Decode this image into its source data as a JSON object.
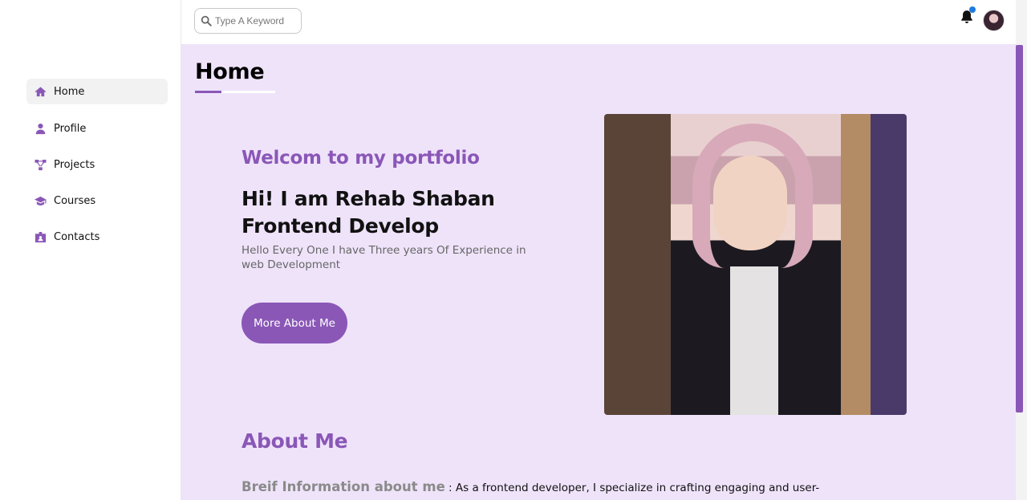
{
  "sidebar": {
    "items": [
      {
        "label": "Home",
        "icon": "home-icon",
        "active": true
      },
      {
        "label": "Profile",
        "icon": "user-icon"
      },
      {
        "label": "Projects",
        "icon": "sitemap-icon"
      },
      {
        "label": "Courses",
        "icon": "graduation-cap-icon"
      },
      {
        "label": "Contacts",
        "icon": "id-card-icon"
      }
    ]
  },
  "header": {
    "search_placeholder": "Type A Keyword",
    "notification_icon": "bell-icon"
  },
  "main": {
    "page_title": "Home",
    "welcome": "Welcom to my portfolio",
    "hero_line1": "Hi! I am Rehab Shaban",
    "hero_line2": "Frontend Develop",
    "hero_description": "Hello Every One I have Three years Of Experience in web Development",
    "more_button": "More About Me",
    "about_title": "About Me",
    "about_label": "Breif Information about me",
    "about_text": " : As a frontend developer, I specialize in crafting engaging and user-"
  },
  "colors": {
    "accent": "#8a57b7",
    "main_bg": "#efe3fa",
    "notification_dot": "#1f7be0"
  }
}
